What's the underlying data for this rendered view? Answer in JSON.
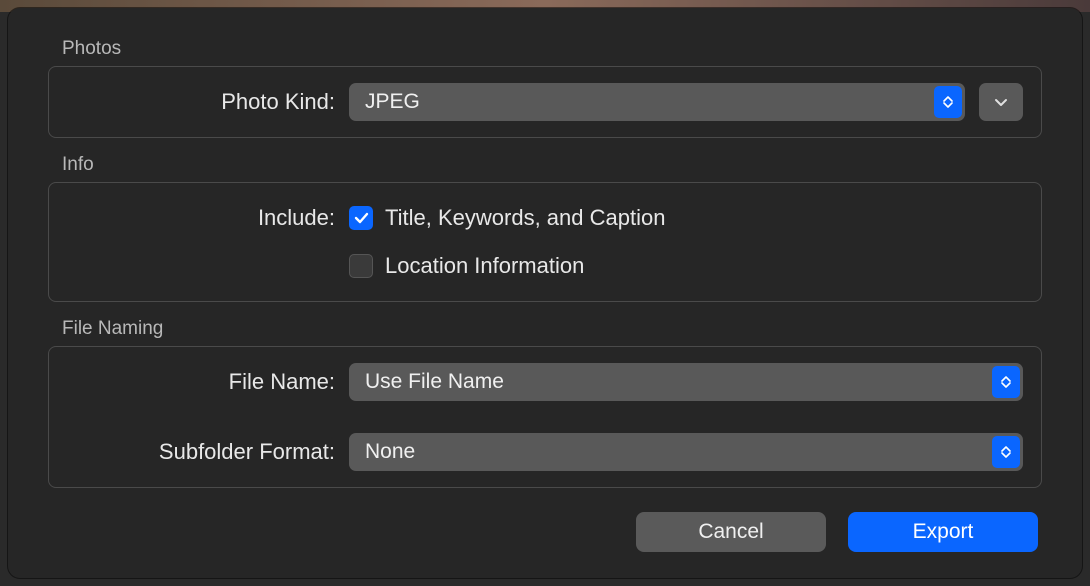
{
  "sections": {
    "photos": {
      "title": "Photos",
      "photo_kind_label": "Photo Kind:",
      "photo_kind_value": "JPEG"
    },
    "info": {
      "title": "Info",
      "include_label": "Include:",
      "title_keywords_caption": "Title, Keywords, and Caption",
      "location_information": "Location Information"
    },
    "file_naming": {
      "title": "File Naming",
      "file_name_label": "File Name:",
      "file_name_value": "Use File Name",
      "subfolder_label": "Subfolder Format:",
      "subfolder_value": "None"
    }
  },
  "buttons": {
    "cancel": "Cancel",
    "export": "Export"
  },
  "checkbox_states": {
    "title_keywords_caption": true,
    "location_information": false
  }
}
